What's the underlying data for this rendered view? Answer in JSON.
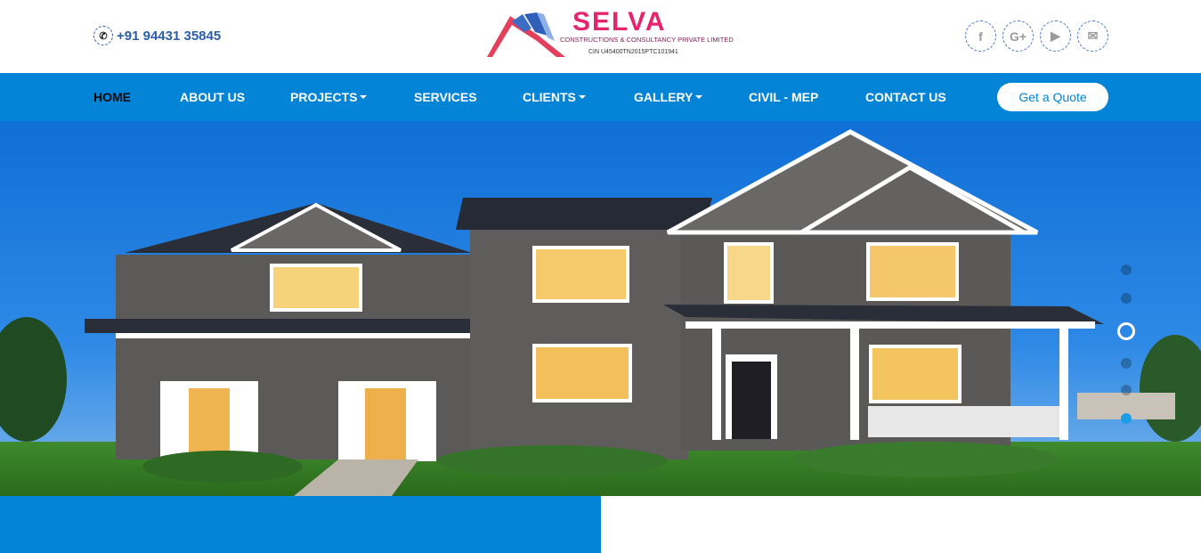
{
  "header": {
    "phone": "+91 94431 35845",
    "logo": {
      "name": "SELVA",
      "subtitle": "CONSTRUCTIONS & CONSULTANCY PRIVATE LIMITED",
      "cin": "CIN U45400TN2015PTC101941"
    },
    "social": [
      {
        "icon": "facebook-icon",
        "glyph": "f"
      },
      {
        "icon": "google-plus-icon",
        "glyph": "G+"
      },
      {
        "icon": "youtube-icon",
        "glyph": "▶"
      },
      {
        "icon": "mail-icon",
        "glyph": "✉"
      }
    ]
  },
  "nav": {
    "items": [
      {
        "label": "HOME",
        "active": true,
        "dropdown": false
      },
      {
        "label": "ABOUT US",
        "active": false,
        "dropdown": false
      },
      {
        "label": "PROJECTS",
        "active": false,
        "dropdown": true
      },
      {
        "label": "SERVICES",
        "active": false,
        "dropdown": false
      },
      {
        "label": "CLIENTS",
        "active": false,
        "dropdown": true
      },
      {
        "label": "GALLERY",
        "active": false,
        "dropdown": true
      },
      {
        "label": "CIVIL - MEP",
        "active": false,
        "dropdown": false
      },
      {
        "label": "CONTACT US",
        "active": false,
        "dropdown": false
      }
    ],
    "quote_label": "Get a Quote"
  },
  "slider": {
    "slide_count": 6,
    "active_index": 2
  },
  "colors": {
    "brand_blue": "#0484d6",
    "logo_pink": "#e6246e",
    "phone_blue": "#2b5ea8"
  }
}
